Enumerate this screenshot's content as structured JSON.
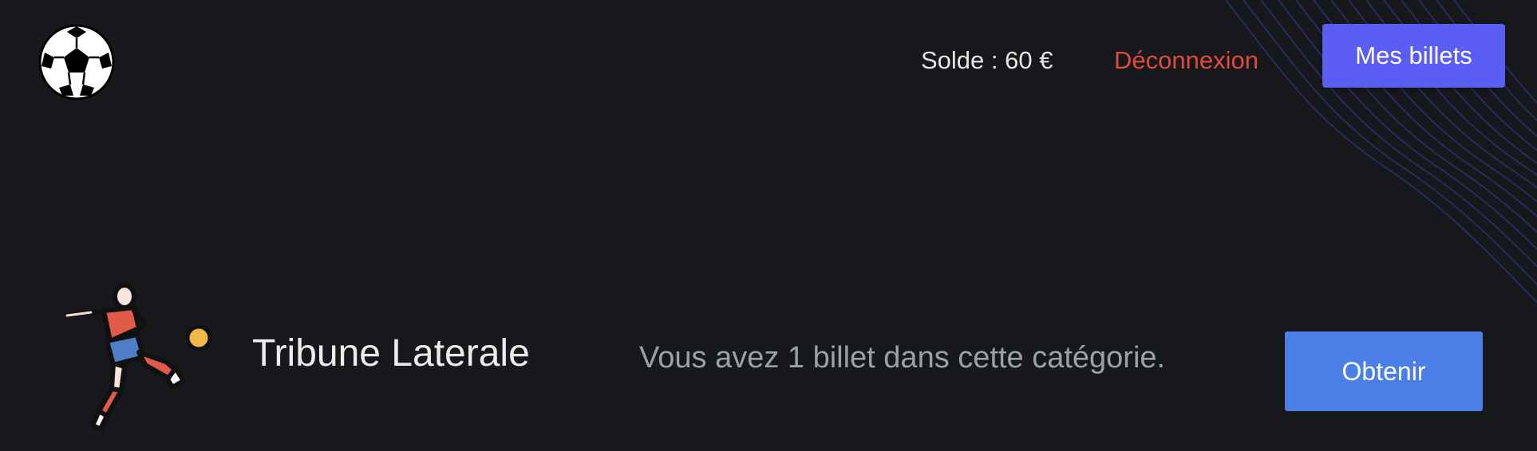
{
  "header": {
    "logo_icon": "soccer-ball-icon",
    "balance_text": "Solde : 60 €",
    "logout_label": "Déconnexion",
    "my_tickets_label": "Mes billets"
  },
  "category": {
    "icon": "soccer-player-kicking-icon",
    "name": "Tribune Laterale",
    "info_text": "Vous avez 1 billet dans cette catégorie.",
    "obtain_label": "Obtenir"
  },
  "colors": {
    "background": "#17181b",
    "logout": "#e04a3f",
    "primary_button": "#5b5ef4",
    "obtain_button": "#4a7fe8",
    "wave_lines": "#2a2b5c"
  }
}
